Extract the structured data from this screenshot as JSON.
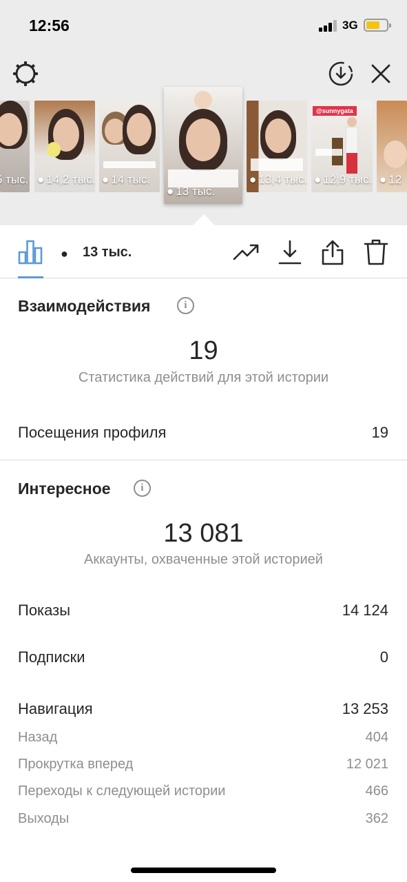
{
  "status_bar": {
    "time": "12:56",
    "network": "3G"
  },
  "toolbar_top": {
    "settings_icon": "gear-icon",
    "download_icon": "download-circle-icon",
    "close_icon": "close-icon"
  },
  "stories": [
    {
      "views": "5 тыс."
    },
    {
      "views": "14,2 тыс."
    },
    {
      "views": "14 тыс."
    },
    {
      "views": "13 тыс.",
      "selected": true
    },
    {
      "views": "13,4 тыс."
    },
    {
      "views": "12,9 тыс.",
      "tag": "@sunnygata"
    },
    {
      "views": "12"
    }
  ],
  "tabs": {
    "insights_icon": "bar-chart-icon",
    "views_label": "13 тыс.",
    "actions": [
      "trending-icon",
      "download-icon",
      "share-icon",
      "trash-icon"
    ]
  },
  "interactions": {
    "title": "Взаимодействия",
    "total": "19",
    "subtitle": "Статистика действий для этой истории",
    "rows": [
      {
        "label": "Посещения профиля",
        "value": "19"
      }
    ]
  },
  "discovery": {
    "title": "Интересное",
    "total": "13 081",
    "subtitle": "Аккаунты, охваченные этой историей",
    "rows": [
      {
        "label": "Показы",
        "value": "14 124"
      },
      {
        "label": "Подписки",
        "value": "0"
      },
      {
        "label": "Навигация",
        "value": "13 253"
      }
    ],
    "navigation": [
      {
        "label": "Назад",
        "value": "404"
      },
      {
        "label": "Прокрутка вперед",
        "value": "12 021"
      },
      {
        "label": "Переходы к следующей истории",
        "value": "466"
      },
      {
        "label": "Выходы",
        "value": "362"
      }
    ]
  },
  "colors": {
    "accent": "#5b9bd5",
    "battery": "#f5c410",
    "muted": "#8e8e8e"
  }
}
